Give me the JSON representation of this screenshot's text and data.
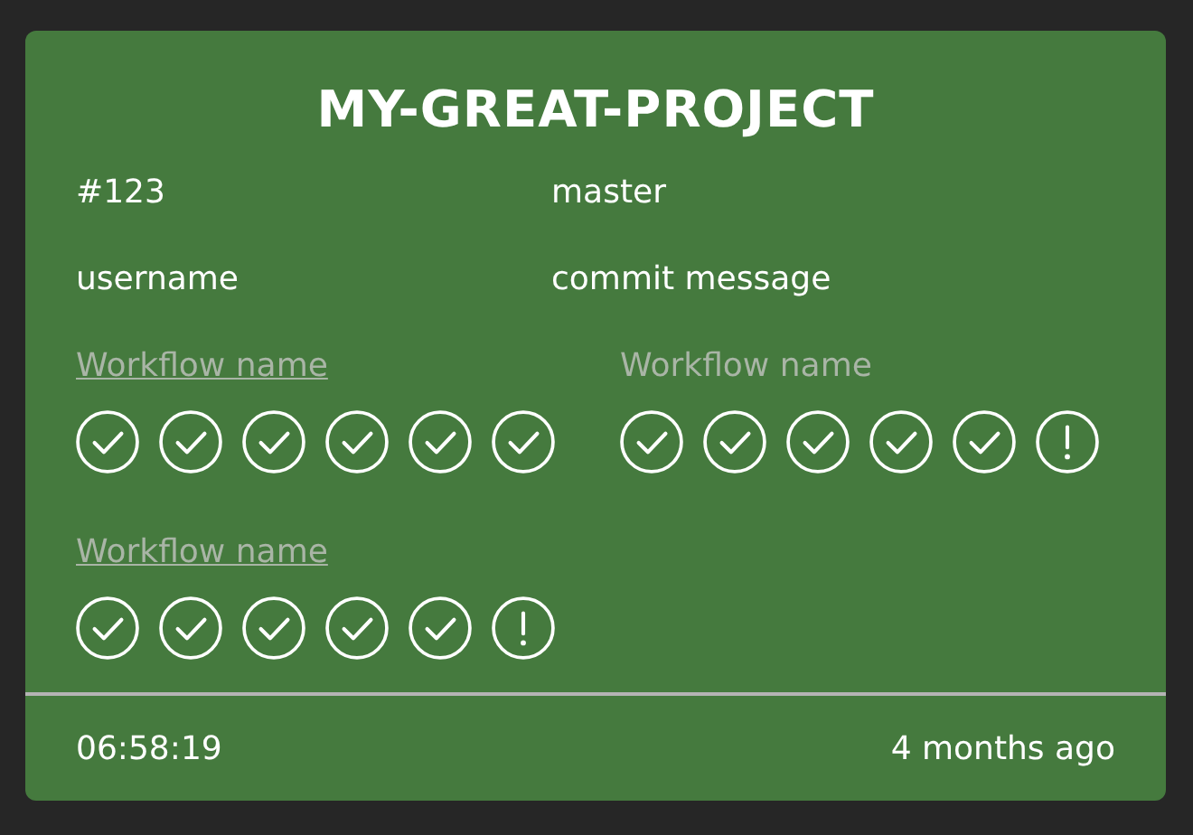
{
  "title": "MY-GREAT-PROJECT",
  "info": [
    {
      "label": "#123"
    },
    {
      "label": "master"
    },
    {
      "label": "username"
    },
    {
      "label": "commit message"
    }
  ],
  "workflows": [
    {
      "name": "Workflow name",
      "linked": true,
      "jobs": [
        {
          "kind": "success"
        },
        {
          "kind": "success"
        },
        {
          "kind": "success"
        },
        {
          "kind": "success"
        },
        {
          "kind": "success"
        },
        {
          "kind": "success"
        }
      ]
    },
    {
      "name": "Workflow name",
      "linked": false,
      "jobs": [
        {
          "kind": "success"
        },
        {
          "kind": "success"
        },
        {
          "kind": "success"
        },
        {
          "kind": "success"
        },
        {
          "kind": "success"
        },
        {
          "kind": "warning"
        }
      ]
    },
    {
      "name": "Workflow name",
      "linked": true,
      "jobs": [
        {
          "kind": "success"
        },
        {
          "kind": "success"
        },
        {
          "kind": "success"
        },
        {
          "kind": "success"
        },
        {
          "kind": "success"
        },
        {
          "kind": "warning"
        }
      ]
    }
  ],
  "footer": {
    "duration": "06:58:19",
    "age": "4 months ago"
  }
}
